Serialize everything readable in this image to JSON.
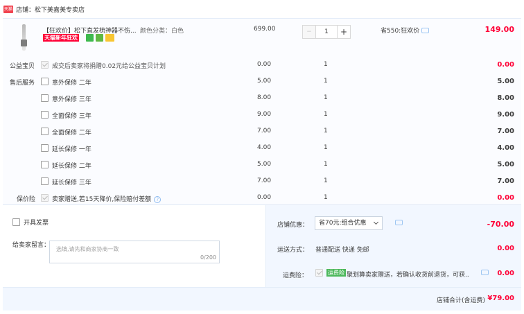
{
  "store": {
    "badge": "天猫",
    "label": "店铺：松下美嘉美专卖店"
  },
  "item": {
    "title": "【狂欢价】松下直发梳神器不伤...",
    "sku": "颜色分类：白色",
    "promo": "天猫新年狂欢",
    "price": "699.00",
    "quantity": "1",
    "minus": "−",
    "plus": "+",
    "savings": "省550:狂欢价",
    "subtotal": "149.00"
  },
  "services": [
    {
      "label": "公益宝贝",
      "name": "成交后卖家将捐赠0.02元给公益宝贝计划",
      "price": "0.00",
      "qty": "1",
      "total": "0.00",
      "disabled": true,
      "red": true
    },
    {
      "label": "售后服务",
      "name": "意外保修 二年",
      "price": "5.00",
      "qty": "1",
      "total": "5.00"
    },
    {
      "label": "",
      "name": "意外保修 三年",
      "price": "8.00",
      "qty": "1",
      "total": "8.00"
    },
    {
      "label": "",
      "name": "全面保修 三年",
      "price": "9.00",
      "qty": "1",
      "total": "9.00"
    },
    {
      "label": "",
      "name": "全面保修 二年",
      "price": "7.00",
      "qty": "1",
      "total": "7.00"
    },
    {
      "label": "",
      "name": "延长保修 一年",
      "price": "4.00",
      "qty": "1",
      "total": "4.00"
    },
    {
      "label": "",
      "name": "延长保修 二年",
      "price": "5.00",
      "qty": "1",
      "total": "5.00"
    },
    {
      "label": "",
      "name": "延长保修 三年",
      "price": "7.00",
      "qty": "1",
      "total": "7.00"
    },
    {
      "label": "保价险",
      "name": "卖家赠送,若15天降价,保险赔付差额",
      "price": "0.00",
      "qty": "1",
      "total": "0.00",
      "disabled": true,
      "red": true,
      "info": true
    }
  ],
  "info_glyph": "?",
  "invoice": {
    "label": "开具发票"
  },
  "message": {
    "label": "给卖家留言：",
    "placeholder": "选填,请先和商家协商一致",
    "count": "0/200"
  },
  "coupon": {
    "label": "店铺优惠：",
    "selected": "省70元:组合优惠",
    "value": "-70.00"
  },
  "shipping": {
    "label": "运送方式：",
    "method": "普通配送 快递 免邮",
    "value": "0.00"
  },
  "insurance": {
    "label": "运费险：",
    "tag": "运费险",
    "text": "聚划算卖家赠送，若确认收货前退货，可获...",
    "value": "0.00"
  },
  "total": {
    "label": "店铺合计(含运费)",
    "value": "¥79.00"
  },
  "colors": {
    "accent_red": "#ff0036",
    "panel_blue": "#f2f7ff",
    "link_blue": "#8cbaf0"
  }
}
